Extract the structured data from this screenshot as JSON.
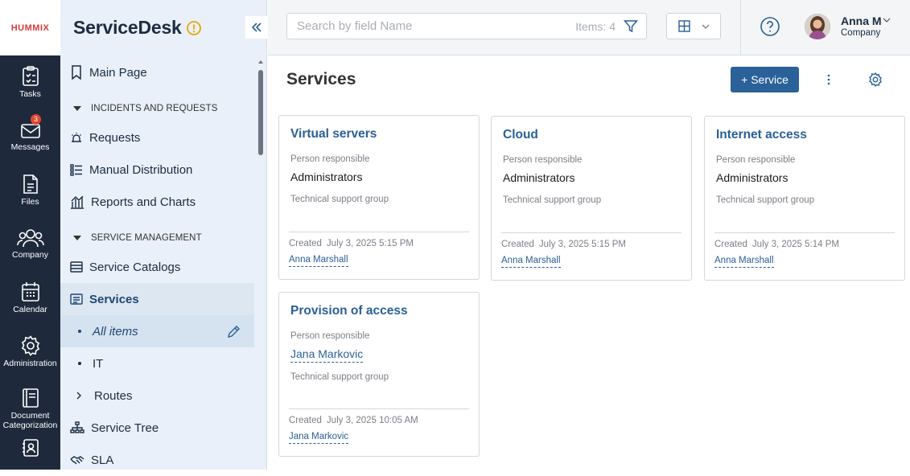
{
  "brand": {
    "logo": "HUMMIX",
    "bg": "#1e2a3c",
    "accent": "#2a6199"
  },
  "rail": {
    "items": [
      {
        "label": "Tasks",
        "icon": "tasks-icon"
      },
      {
        "label": "Messages",
        "icon": "messages-icon",
        "badge": "3"
      },
      {
        "label": "Files",
        "icon": "files-icon"
      },
      {
        "label": "Company",
        "icon": "company-icon"
      },
      {
        "label": "Calendar",
        "icon": "calendar-icon"
      },
      {
        "label": "Administration",
        "icon": "gear-icon"
      },
      {
        "label": "Document Categorization",
        "icon": "document-icon"
      },
      {
        "label": "",
        "icon": "contacts-icon"
      }
    ]
  },
  "nav": {
    "title": "ServiceDesk",
    "items": {
      "main": "Main Page",
      "sec1": "INCIDENTS AND REQUESTS",
      "requests": "Requests",
      "manual": "Manual Distribution",
      "reports": "Reports and Charts",
      "sec2": "SERVICE MANAGEMENT",
      "catalogs": "Service Catalogs",
      "services": "Services",
      "all": "All items",
      "it": "IT",
      "routes": "Routes",
      "tree": "Service Tree",
      "sla": "SLA"
    }
  },
  "topbar": {
    "search_placeholder": "Search by field Name",
    "items_count": "Items: 4",
    "user_name": "Anna M",
    "user_company": "Company"
  },
  "page": {
    "title": "Services",
    "add_label": "+ Service"
  },
  "cards": [
    {
      "title": "Virtual servers",
      "person_label": "Person responsible",
      "person": "Administrators",
      "group_label": "Technical support group",
      "created_label": "Created",
      "created": "July 3, 2025 5:15 PM",
      "author": "Anna Marshall"
    },
    {
      "title": "Cloud",
      "person_label": "Person responsible",
      "person": "Administrators",
      "group_label": "Technical support group",
      "created_label": "Created",
      "created": "July 3, 2025 5:15 PM",
      "author": "Anna Marshall"
    },
    {
      "title": "Internet access",
      "person_label": "Person responsible",
      "person": "Administrators",
      "group_label": "Technical support group",
      "created_label": "Created",
      "created": "July 3, 2025 5:14 PM",
      "author": "Anna Marshall"
    },
    {
      "title": "Provision of access",
      "person_label": "Person responsible",
      "person": "Jana Markovic",
      "group_label": "Technical support group",
      "created_label": "Created",
      "created": "July 3, 2025 10:05 AM",
      "author": "Jana Markovic"
    }
  ]
}
